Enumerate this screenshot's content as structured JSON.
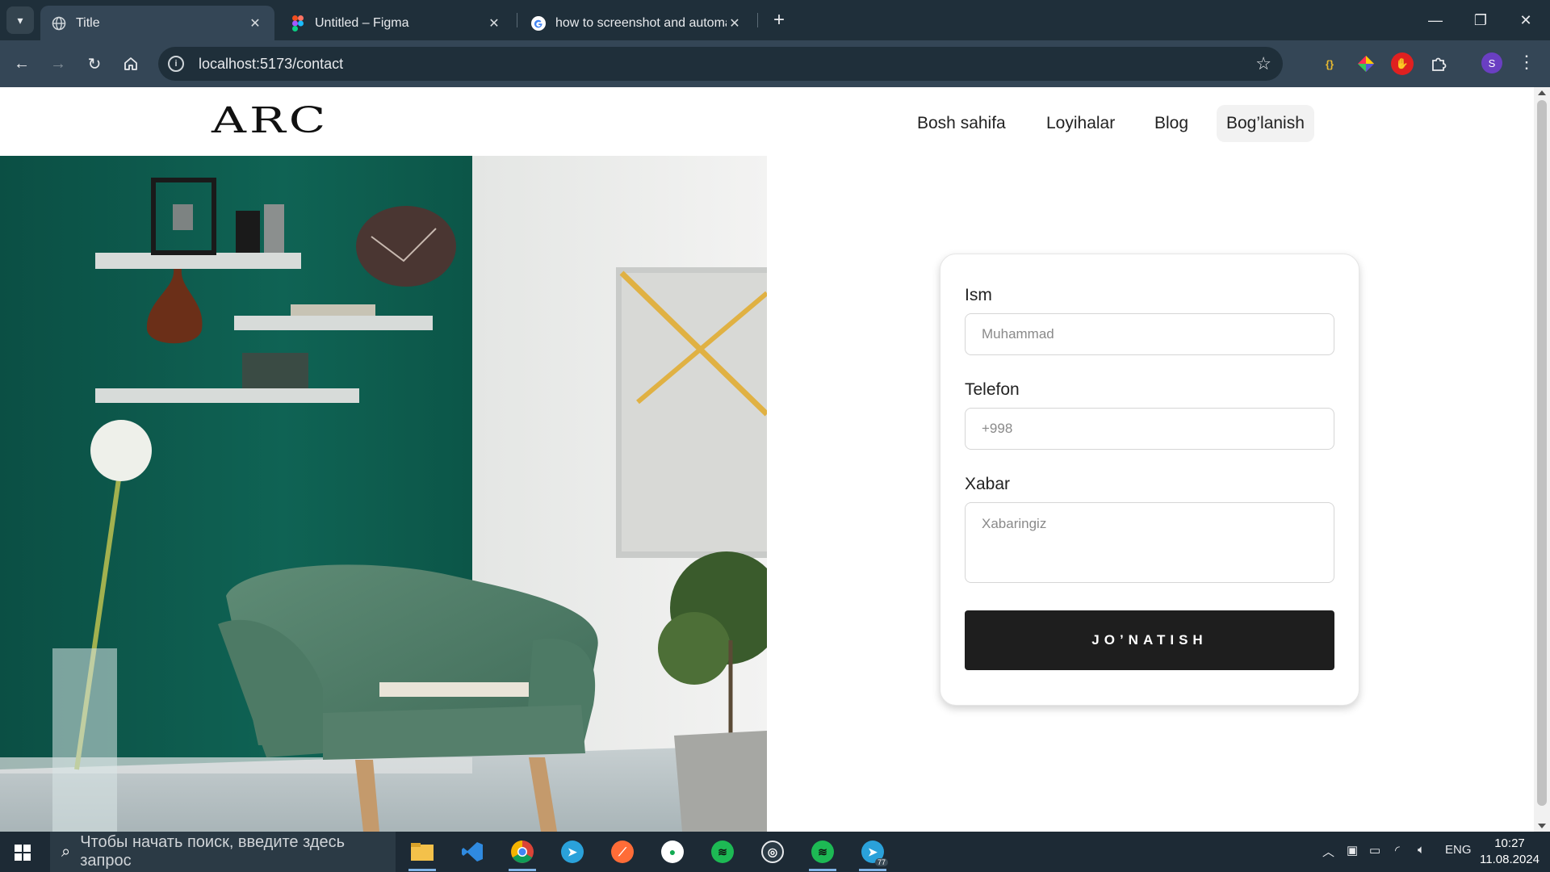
{
  "browser": {
    "tabs": [
      {
        "title": "Title",
        "active": true
      },
      {
        "title": "Untitled – Figma",
        "active": false
      },
      {
        "title": "how to screenshot and automat",
        "active": false
      }
    ],
    "url": "localhost:5173/contact",
    "profile_initial": "S",
    "extensions": [
      "json-viewer-icon",
      "color-picker-icon",
      "adblock-icon",
      "puzzle-icon"
    ]
  },
  "site": {
    "logo": "ARC",
    "nav": [
      {
        "label": "Bosh sahifa"
      },
      {
        "label": "Loyihalar"
      },
      {
        "label": "Blog"
      },
      {
        "label": "Bog’lanish",
        "active": true
      }
    ]
  },
  "form": {
    "name_label": "Ism",
    "name_placeholder": "Muhammad",
    "phone_label": "Telefon",
    "phone_placeholder": "+998",
    "message_label": "Xabar",
    "message_placeholder": "Xabaringiz",
    "submit_label": "JO’NATISH"
  },
  "taskbar": {
    "search_placeholder": "Чтобы начать поиск, введите здесь запрос",
    "apps": [
      "file-explorer-icon",
      "vscode-icon",
      "chrome-icon",
      "telegram-icon",
      "postman-icon",
      "mongodb-compass-icon",
      "spotify-icon",
      "obs-icon",
      "spotify-icon",
      "telegram-icon"
    ],
    "telegram_badge": "77",
    "language": "ENG",
    "time": "10:27",
    "date": "11.08.2024"
  },
  "colors": {
    "chrome_dark": "#1f2f3a",
    "chrome_toolbar": "#344656",
    "button_dark": "#1e1e1e",
    "wall_green": "#0e5a4c"
  }
}
